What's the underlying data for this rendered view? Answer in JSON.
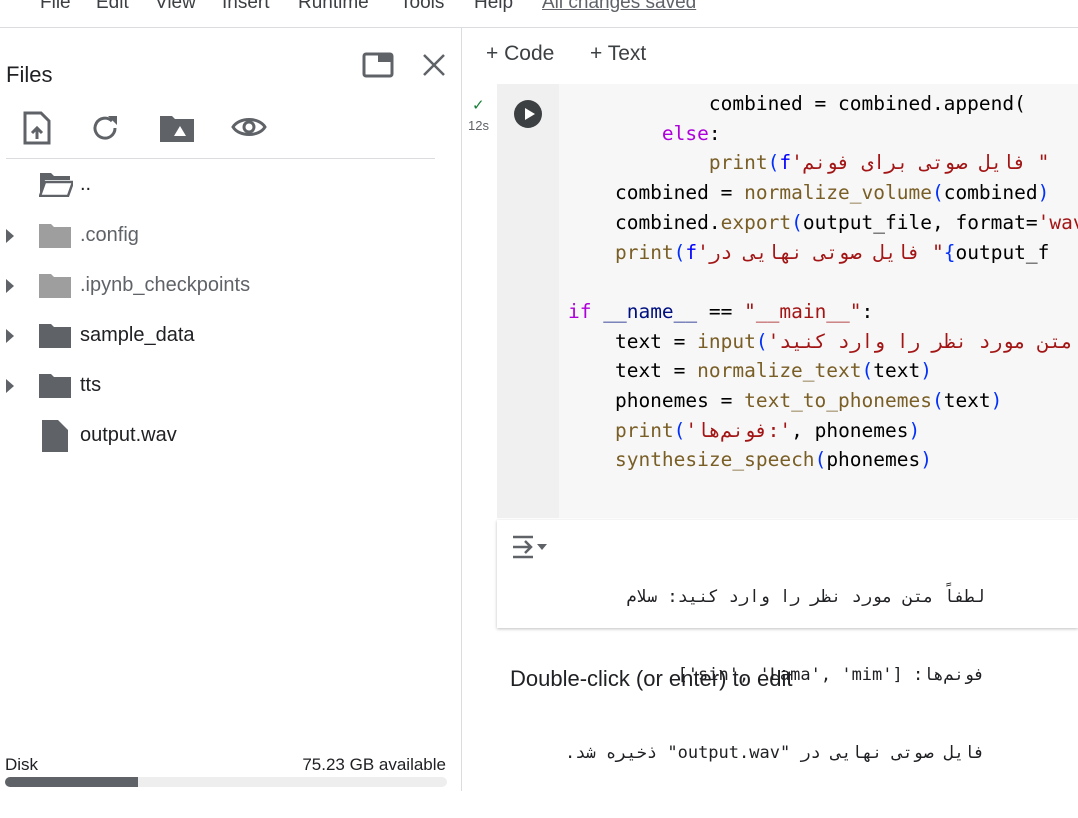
{
  "menu": {
    "items": [
      "File",
      "Edit",
      "View",
      "Insert",
      "Runtime",
      "Tools",
      "Help"
    ],
    "status": "All changes saved"
  },
  "sidebar": {
    "title": "Files",
    "toolbar_icons": [
      "upload-file-icon",
      "refresh-icon",
      "mount-drive-icon",
      "eye-icon"
    ],
    "tree": [
      {
        "label": "..",
        "type": "folder-open",
        "expandable": false
      },
      {
        "label": ".config",
        "type": "folder-hidden",
        "expandable": true
      },
      {
        "label": ".ipynb_checkpoints",
        "type": "folder-hidden",
        "expandable": true
      },
      {
        "label": "sample_data",
        "type": "folder",
        "expandable": true
      },
      {
        "label": "tts",
        "type": "folder",
        "expandable": true
      },
      {
        "label": "output.wav",
        "type": "file",
        "expandable": false
      }
    ],
    "disk": {
      "label": "Disk",
      "available": "75.23 GB available",
      "used_fraction": 0.3
    }
  },
  "toolbar": {
    "code_label": "+ Code",
    "text_label": "+ Text"
  },
  "cell": {
    "exec_time": "12s",
    "status": "success",
    "code_lines": [
      [
        [
          "df",
          "            combined = combined.append("
        ]
      ],
      [
        [
          "df",
          "        "
        ],
        [
          "kw",
          "else"
        ],
        [
          "df",
          ":"
        ]
      ],
      [
        [
          "df",
          "            "
        ],
        [
          "fn",
          "print"
        ],
        [
          "pn",
          "("
        ],
        [
          "fk",
          "f"
        ],
        [
          "st",
          "'فایل صوتی برای فونم \""
        ]
      ],
      [
        [
          "df",
          "    combined = "
        ],
        [
          "fn",
          "normalize_volume"
        ],
        [
          "pn",
          "("
        ],
        [
          "df",
          "combined"
        ],
        [
          "pn",
          ")"
        ]
      ],
      [
        [
          "df",
          "    combined."
        ],
        [
          "fn",
          "export"
        ],
        [
          "pn",
          "("
        ],
        [
          "df",
          "output_file, format="
        ],
        [
          "st",
          "'wav"
        ]
      ],
      [
        [
          "df",
          "    "
        ],
        [
          "fn",
          "print"
        ],
        [
          "pn",
          "("
        ],
        [
          "fk",
          "f"
        ],
        [
          "st",
          "'فایل صوتی نهایی در \""
        ],
        [
          "pn",
          "{"
        ],
        [
          "df",
          "output_f"
        ]
      ],
      [
        [
          "df",
          ""
        ]
      ],
      [
        [
          "kw",
          "if"
        ],
        [
          "df",
          " "
        ],
        [
          "bl",
          "__name__"
        ],
        [
          "df",
          " == "
        ],
        [
          "st",
          "\"__main__\""
        ],
        [
          "df",
          ":"
        ]
      ],
      [
        [
          "df",
          "    text = "
        ],
        [
          "fn",
          "input"
        ],
        [
          "pn",
          "("
        ],
        [
          "st",
          "'متن مورد نظر را وارد کنید"
        ]
      ],
      [
        [
          "df",
          "    text = "
        ],
        [
          "fn",
          "normalize_text"
        ],
        [
          "pn",
          "("
        ],
        [
          "df",
          "text"
        ],
        [
          "pn",
          ")"
        ]
      ],
      [
        [
          "df",
          "    phonemes = "
        ],
        [
          "fn",
          "text_to_phonemes"
        ],
        [
          "pn",
          "("
        ],
        [
          "df",
          "text"
        ],
        [
          "pn",
          ")"
        ]
      ],
      [
        [
          "df",
          "    "
        ],
        [
          "fn",
          "print"
        ],
        [
          "pn",
          "("
        ],
        [
          "st",
          "'فونم‌ها:'"
        ],
        [
          "df",
          ", phonemes"
        ],
        [
          "pn",
          ")"
        ]
      ],
      [
        [
          "df",
          "    "
        ],
        [
          "fn",
          "synthesize_speech"
        ],
        [
          "pn",
          "("
        ],
        [
          "df",
          "phonemes"
        ],
        [
          "pn",
          ")"
        ]
      ]
    ],
    "output_lines": [
      "لطفاً متن مورد نظر را وارد کنید: سلام",
      "فونم‌ها: ['sin', 'Lama', 'mim']",
      "فایل صوتی نهایی در \"output.wav\" ذخیره شد."
    ]
  },
  "text_cell": {
    "placeholder": "Double-click (or enter) to edit"
  }
}
